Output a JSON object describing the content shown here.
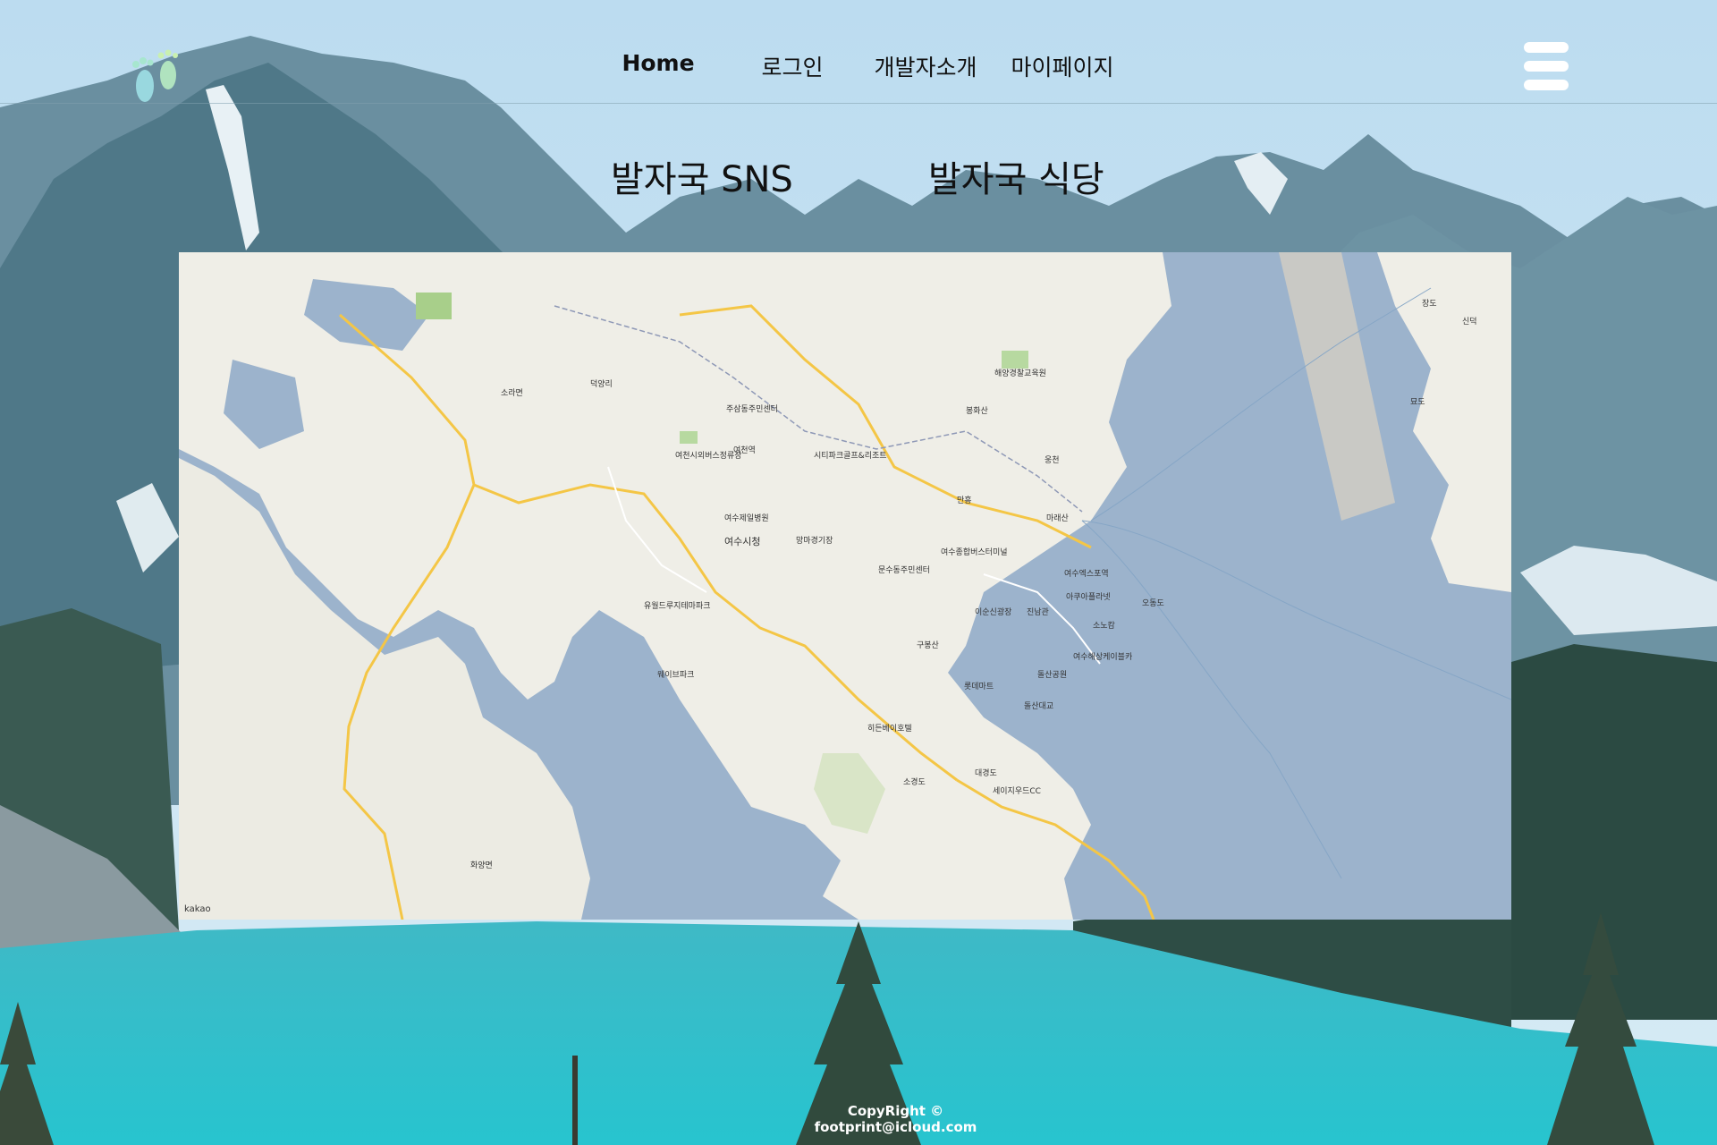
{
  "header": {
    "nav": {
      "home": "Home",
      "login": "로그인",
      "developer": "개발자소개",
      "mypage": "마이페이지"
    }
  },
  "tabs": {
    "sns": "발자국 SNS",
    "restaurant": "발자국 식당"
  },
  "map": {
    "attribution": "kakao",
    "labels": [
      "여수시청",
      "여수제일병원",
      "여천역",
      "여천시외버스정류장",
      "주삼동주민센터",
      "문수동주민센터",
      "여수종합버스터미널",
      "여수엑스포역",
      "오동도",
      "소노캄",
      "진남관",
      "여수해상케이블카",
      "돌산공원",
      "롯데마트",
      "해양경찰교육원",
      "웅천",
      "장도",
      "소경도",
      "대경도",
      "세이지우드CC",
      "화양면",
      "소라면",
      "묘도",
      "신덕",
      "덕양리",
      "봉화산",
      "구봉산",
      "마래산",
      "만흥",
      "웨이브파크",
      "유월드루지테마파크",
      "히든베이호텔",
      "시티파크골프&리조트",
      "망마경기장",
      "이순신광장",
      "돌산대교",
      "아쿠아플라넷"
    ]
  },
  "footer": {
    "copyright": "CopyRight © footprint@icloud.com"
  },
  "colors": {
    "sky": "#c3ddef",
    "lake": "#2fc0cc",
    "forest": "#2b4a42",
    "map_water": "#9cb3cc",
    "map_land": "#efeee7",
    "road_yellow": "#f4c646"
  },
  "icons": {
    "logo": "footprint-icon",
    "menu": "hamburger-menu-icon"
  }
}
